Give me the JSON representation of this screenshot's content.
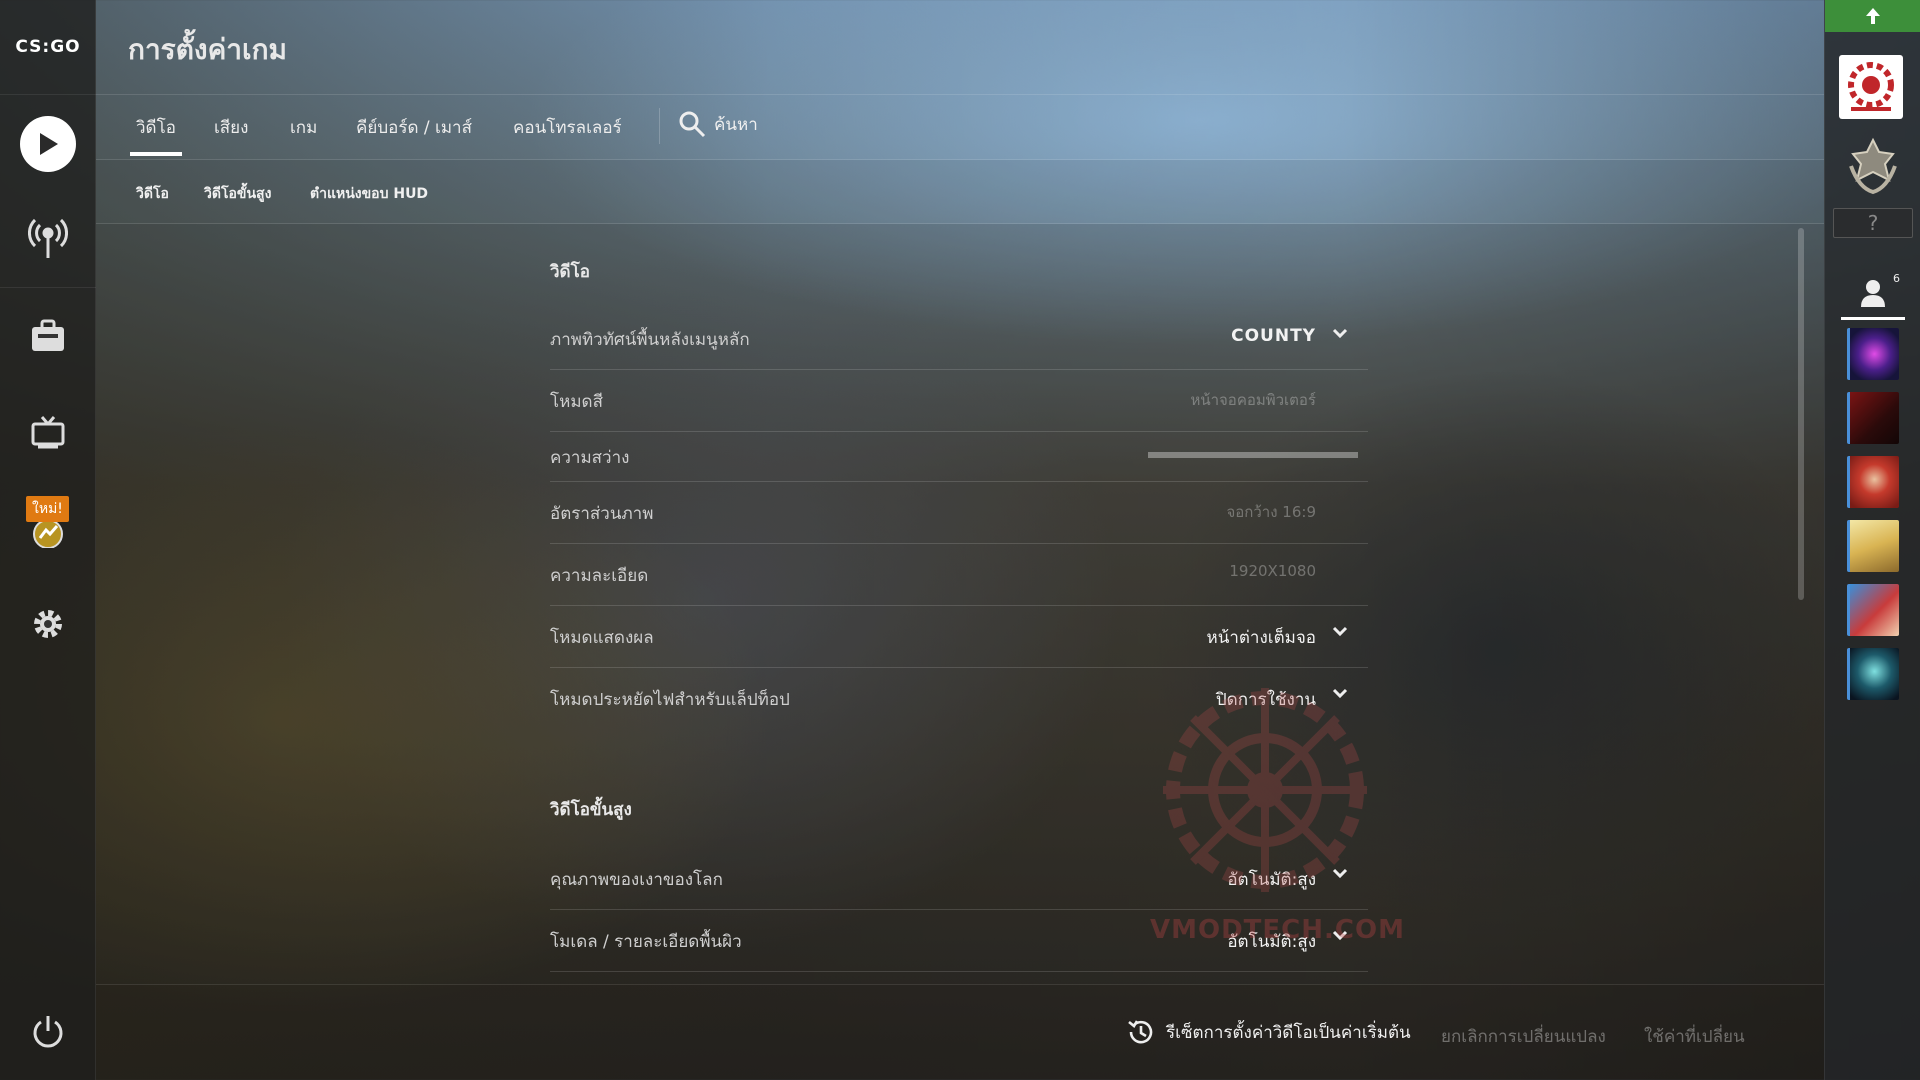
{
  "app": {
    "logo_text": "CS:GO",
    "title": "การตั้งค่าเกม"
  },
  "left_nav": {
    "new_badge": "ใหม่!"
  },
  "tabs": [
    {
      "label": "วิดีโอ",
      "active": true
    },
    {
      "label": "เสียง"
    },
    {
      "label": "เกม"
    },
    {
      "label": "คีย์บอร์ด / เมาส์"
    },
    {
      "label": "คอนโทรลเลอร์"
    }
  ],
  "search": {
    "label": "ค้นหา"
  },
  "subtabs": [
    {
      "label": "วิดีโอ"
    },
    {
      "label": "วิดีโอขั้นสูง"
    },
    {
      "label": "ตำแหน่งขอบ HUD"
    }
  ],
  "sections": {
    "video": {
      "title": "วิดีโอ",
      "rows": [
        {
          "label": "ภาพทิวทัศน์พื้นหลังเมนูหลัก",
          "value": "COUNTY",
          "enabled": true
        },
        {
          "label": "โหมดสี",
          "value": "หน้าจอคอมพิวเตอร์",
          "enabled": false
        },
        {
          "label": "ความสว่าง",
          "value": "",
          "enabled": false
        },
        {
          "label": "อัตราส่วนภาพ",
          "value": "จอกว้าง 16:9",
          "enabled": false
        },
        {
          "label": "ความละเอียด",
          "value": "1920X1080",
          "enabled": false
        },
        {
          "label": "โหมดแสดงผล",
          "value": "หน้าต่างเต็มจอ",
          "enabled": true
        },
        {
          "label": "โหมดประหยัดไฟสำหรับแล็ปท็อป",
          "value": "ปิดการใช้งาน",
          "enabled": true
        }
      ]
    },
    "advanced": {
      "title": "วิดีโอขั้นสูง",
      "rows": [
        {
          "label": "คุณภาพของเงาของโลก",
          "value": "อัตโนมัติ:สูง",
          "enabled": true
        },
        {
          "label": "โมเดล / รายละเอียดพื้นผิว",
          "value": "อัตโนมัติ:สูง",
          "enabled": true
        }
      ]
    }
  },
  "footer": {
    "reset": "รีเซ็ตการตั้งค่าวิดีโอเป็นค่าเริ่มต้น",
    "cancel": "ยกเลิกการเปลี่ยนแปลง",
    "apply": "ใช้ค่าที่เปลี่ยน"
  },
  "right_bar": {
    "unknown_rank": "?",
    "friends_count": "6"
  },
  "watermark": {
    "text": "VMODTECH.COM"
  },
  "colors": {
    "accent_orange": "#e07a12",
    "status_green": "#3d8f3a",
    "friend_online": "#4a90d9"
  }
}
